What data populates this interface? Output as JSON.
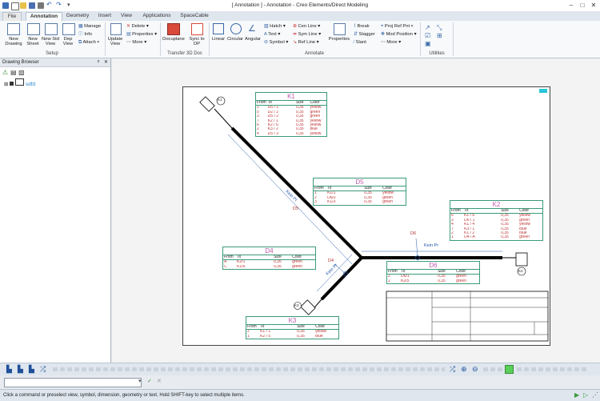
{
  "window": {
    "title": "[ Annotation ] - Annotation - Creo Elements/Direct Modeling"
  },
  "tabs": [
    "File",
    "Annotation",
    "Geometry",
    "Insert",
    "View",
    "Applications",
    "SpaceCable"
  ],
  "ribbon": {
    "setup": {
      "group": "Setup",
      "new_drawing": "New Drawing",
      "new_sheet": "New Sheet",
      "new_std_view": "New Std View",
      "dep_view": "Dep View",
      "manage": "Manage",
      "info": "Info",
      "attach": "Attach"
    },
    "views": {
      "update_view": "Update View",
      "delete": "Delete",
      "properties": "Properties",
      "more": "More"
    },
    "transfer": {
      "group": "Transfer 3D Doc",
      "docuplane": "Docuplane",
      "sync_to_dp": "Sync to DP"
    },
    "annotate": {
      "group": "Annotate",
      "linear": "Linear",
      "circular": "Circular",
      "angular": "Angular",
      "hatch": "Hatch",
      "text": "Text",
      "symbol": "Symbol",
      "cen_line": "Cen Line",
      "sym_line": "Sym Line",
      "ref_line": "Ref Line",
      "properties": "Properties",
      "break": "Break",
      "stagger": "Stagger",
      "slant": "Slant",
      "proj_ref_pnt": "Proj Ref Pnt",
      "mod_position": "Mod Position",
      "more": "More"
    },
    "utilities": {
      "group": "Utilities"
    }
  },
  "browser": {
    "title": "Drawing Browser",
    "tree_item": "sdfd"
  },
  "tables": {
    "k1": {
      "title": "K1",
      "headers": [
        "From",
        "To",
        "Size",
        "Color"
      ],
      "rows": [
        [
          "1",
          "D5 / 1",
          "0,35",
          "yellow"
        ],
        [
          "5",
          "D2 / 2",
          "0,35",
          "green"
        ],
        [
          "3",
          "D5 / 2",
          "0,35",
          "green"
        ],
        [
          "7",
          "K2 / 1",
          "0,35",
          "yellow"
        ],
        [
          "6",
          "K2 / 6",
          "0,35",
          "yellow"
        ],
        [
          "2",
          "K3 / 2",
          "0,35",
          "blue"
        ],
        [
          "4",
          "D5 / 3",
          "0,35",
          "yellow"
        ]
      ]
    },
    "d5": {
      "title": "D5",
      "headers": [
        "From",
        "To",
        "Size",
        "Color"
      ],
      "rows": [
        [
          "1",
          "K1/1",
          "0,35",
          "yellow"
        ],
        [
          "2",
          "D6/2",
          "0,35",
          "green"
        ],
        [
          "3",
          "K1/3",
          "0,35",
          "green"
        ]
      ]
    },
    "k2": {
      "title": "K2",
      "headers": [
        "From",
        "To",
        "Size",
        "Color"
      ],
      "rows": [
        [
          "6",
          "K1 / 6",
          "0,35",
          "yellow"
        ],
        [
          "3",
          "D6 / 1",
          "0,35",
          "green"
        ],
        [
          "4",
          "K1 / 4",
          "0,35",
          "yellow"
        ],
        [
          "7",
          "K3 / 1",
          "0,35",
          "blue"
        ],
        [
          "2",
          "K1 / 2",
          "0,35",
          "blue"
        ],
        [
          "1",
          "D4 / A",
          "0,35",
          "green"
        ]
      ]
    },
    "d4": {
      "title": "D4",
      "headers": [
        "From",
        "To",
        "Size",
        "Color"
      ],
      "rows": [
        [
          "A",
          "K2/1",
          "0,35",
          "green"
        ],
        [
          "C",
          "K1/6",
          "0,35",
          "green"
        ]
      ]
    },
    "d6": {
      "title": "D6",
      "headers": [
        "From",
        "To",
        "Size",
        "Color"
      ],
      "rows": [
        [
          "2",
          "D6/1",
          "0,35",
          "green"
        ],
        [
          "1",
          "K2/5",
          "0,35",
          "green"
        ]
      ]
    },
    "k3": {
      "title": "K3",
      "headers": [
        "From",
        "To",
        "Size",
        "Color"
      ],
      "rows": [
        [
          "2",
          "K1 / 1",
          "0,35",
          "yellow"
        ],
        [
          "1",
          "K2 / 5",
          "0,35",
          "blue"
        ]
      ]
    }
  },
  "drawing_labels": {
    "cable1": "Kein Pr",
    "cable2": "Kein Pr",
    "cable3": "Kein Pr",
    "d5": "D5",
    "d6": "D6",
    "d4": "D4",
    "k1": "K1",
    "k2": "K2",
    "k3": "K3"
  },
  "status": {
    "message": "Click a command or preselect view, symbol, dimension, geometry or text. Hold SHIFT-key to select multiple items."
  }
}
